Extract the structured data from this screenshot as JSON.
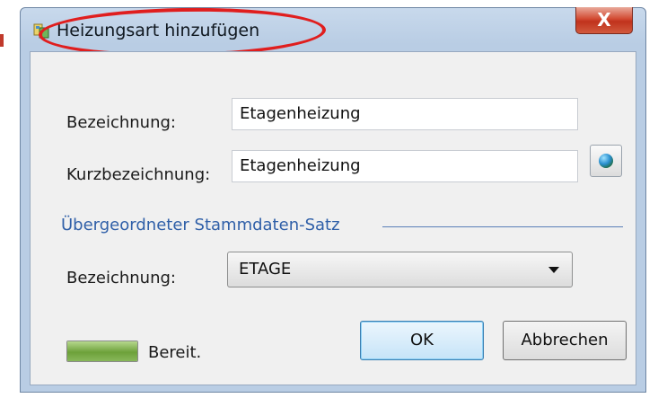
{
  "window": {
    "title": "Heizungsart hinzufügen",
    "close_glyph": "X"
  },
  "form": {
    "bezeichnung_label": "Bezeichnung:",
    "bezeichnung_value": "Etagenheizung",
    "kurzbezeichnung_label": "Kurzbezeichnung:",
    "kurzbezeichnung_value": "Etagenheizung"
  },
  "parent_section": {
    "title": "Übergeordneter Stammdaten-Satz",
    "bezeichnung_label": "Bezeichnung:",
    "selected_value": "ETAGE"
  },
  "buttons": {
    "ok_label": "OK",
    "cancel_label": "Abbrechen"
  },
  "status": {
    "text": "Bereit.",
    "progress": 1.0
  },
  "icons": {
    "app": "app-icon",
    "translate": "globe-icon",
    "dropdown": "chevron-down-icon",
    "close": "close-icon"
  },
  "colors": {
    "section_title": "#2f5fa8",
    "annotation": "#e01e1e",
    "close_button": "#c0321c",
    "progress_fill": "#6da13a"
  }
}
